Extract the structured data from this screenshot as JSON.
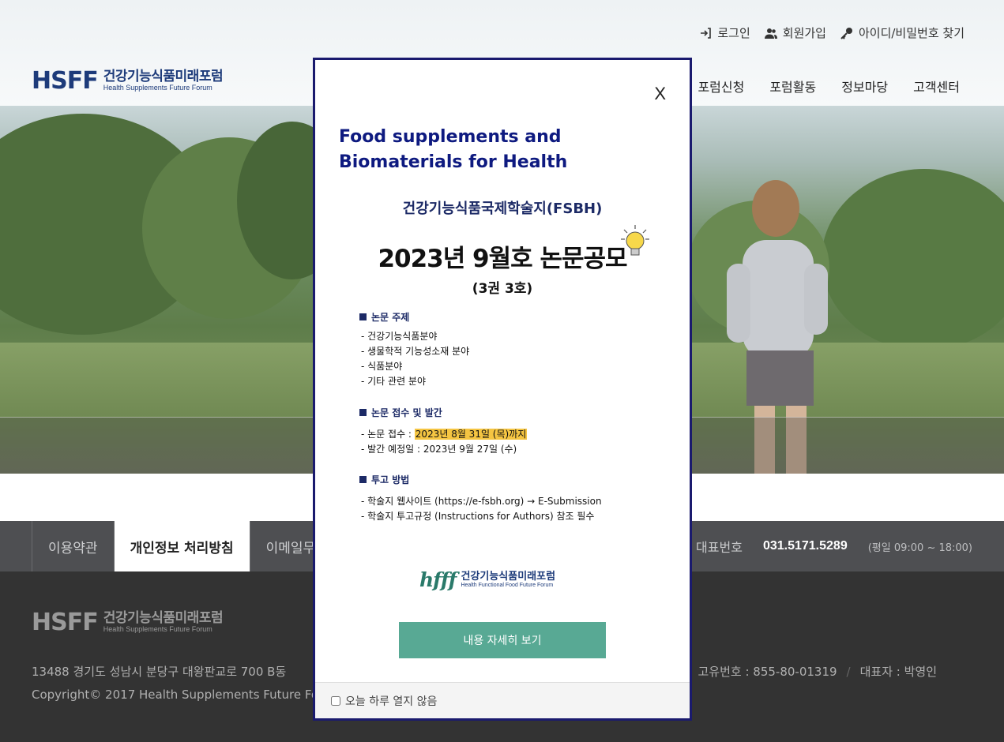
{
  "header": {
    "top_links": [
      {
        "label": "로그인",
        "icon": "login-icon"
      },
      {
        "label": "회원가입",
        "icon": "users-icon"
      },
      {
        "label": "아이디/비밀번호 찾기",
        "icon": "key-icon"
      }
    ],
    "logo": {
      "mark": "HSFF",
      "name_kr": "건강기능식품미래포럼",
      "name_en": "Health Supplements Future Forum"
    },
    "nav": [
      "포럼신청",
      "포럼활동",
      "정보마당",
      "고객센터"
    ]
  },
  "footer_bar": {
    "links": [
      "이용약관",
      "개인정보 처리방침",
      "이메일무단수집거부"
    ],
    "rep_label": "대표번호",
    "rep_number": "031.5171.5289",
    "hours": "(평일 09:00 ~ 18:00)"
  },
  "footer": {
    "logo": {
      "mark": "HSFF",
      "name_kr": "건강기능식품미래포럼",
      "name_en": "Health Supplements Future Forum"
    },
    "address": "13488 경기도 성남시 분당구 대왕판교로 700 B동",
    "biz_no": "고유번호 : 855-80-01319",
    "ceo": "대표자 : 박영인",
    "copyright": "Copyright© 2017 Health Supplements Future Forum"
  },
  "popup": {
    "close_label": "X",
    "title": "Food supplements and Biomaterials for Health",
    "journal": "건강기능식품국제학술지(FSBH)",
    "headline": "2023년 9월호 논문공모",
    "volume": "(3권 3호)",
    "section1_title": "논문 주제",
    "section1_items": [
      "- 건강기능식품분야",
      "- 생물학적 기능성소재 분야",
      "- 식품분야",
      "- 기타 관련 분야"
    ],
    "section2_title": "논문 접수 및 발간",
    "section2_item1_prefix": "- 논문 접수 : ",
    "section2_item1_highlight": "2023년 8월 31일 (목)까지",
    "section2_item2": "- 발간 예정일 : 2023년 9월 27일 (수)",
    "section3_title": "투고 방법",
    "section3_items": [
      "- 학술지 웹사이트 (https://e-fsbh.org) → E-Submission",
      "- 학술지 투고규정 (Instructions for Authors) 참조 필수"
    ],
    "logo": {
      "mark": "hfff",
      "name_kr": "건강기능식품미래포럼",
      "name_en": "Health Functional Food Future Forum"
    },
    "button_label": "내용 자세히 보기",
    "dont_show_label": "오늘 하루 열지 않음"
  },
  "colors": {
    "brand_navy": "#1d3b7a",
    "popup_title": "#0e1a80",
    "button": "#58a994",
    "highlight": "#f5c542"
  }
}
